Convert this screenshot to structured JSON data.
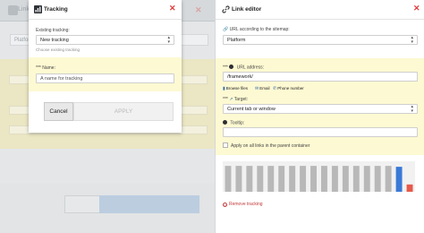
{
  "colors": {
    "accent_blue": "#2f6fb6",
    "highlight_yellow": "#fdf9d2",
    "close_red": "#e03b3b",
    "chart_grey": "#b8b8b8",
    "chart_blue": "#3a79d6",
    "chart_red": "#e55a4b"
  },
  "background": {
    "title": "Link",
    "platform_label": "Platfor"
  },
  "tracking": {
    "title": "Tracking",
    "close_icon": "close-icon",
    "existing_label": "Existing tracking:",
    "existing_value": "New tracking",
    "existing_hint": "Choose existing tracking",
    "name_required": "***",
    "name_label": "Name:",
    "name_placeholder": "A name for tracking",
    "cancel_label": "Cancel",
    "apply_label": "APPLY"
  },
  "link_editor": {
    "title": "Link editor",
    "sitemap_label": "URL according to the sitemap:",
    "sitemap_value": "Platform",
    "url_required": "***",
    "url_label": "URL address:",
    "url_value": "/framework/",
    "browse_files": "Browse files",
    "email": "Email",
    "phone": "Phone number",
    "target_required": "***",
    "target_label": "Target:",
    "target_value": "Current tab or window",
    "tooltip_label": "Tooltip:",
    "tooltip_value": "",
    "apply_all_label": "Apply on all links in the parent container",
    "remove_tracking": "Remove tracking"
  },
  "chart_data": {
    "type": "bar",
    "categories": [
      "",
      "",
      "",
      "",
      "",
      "",
      "",
      "",
      "",
      "",
      "",
      "",
      "",
      "",
      "",
      "",
      "",
      ""
    ],
    "values": [
      0.85,
      0.85,
      0.85,
      0.85,
      0.85,
      0.85,
      0.85,
      0.85,
      0.85,
      0.85,
      0.85,
      0.85,
      0.85,
      0.85,
      0.85,
      0.85,
      0.85,
      0.85
    ],
    "highlight_series": [
      {
        "index": 16,
        "value": 0.82,
        "color": "#3a79d6"
      },
      {
        "index": 17,
        "value": 0.24,
        "color": "#e55a4b"
      }
    ],
    "title": "",
    "xlabel": "",
    "ylabel": "",
    "grid": false
  }
}
